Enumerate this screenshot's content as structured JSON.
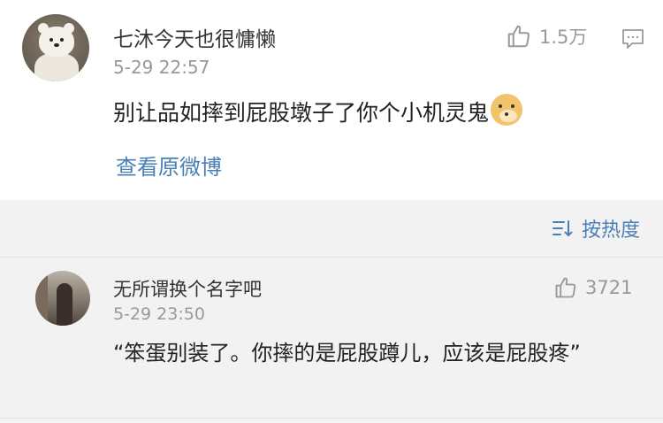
{
  "main_comment": {
    "username": "七沐今天也很慵懒",
    "timestamp": "5-29 22:57",
    "text": "别让品如摔到屁股墩子了你个小机灵鬼",
    "emoji": "doge-emoji",
    "like_count": "1.5万",
    "view_original": "查看原微博"
  },
  "sort": {
    "label": "按热度",
    "icon": "sort-icon"
  },
  "reply": {
    "username": "无所谓换个名字吧",
    "timestamp": "5-29 23:50",
    "text": "“笨蛋别装了。你摔的是屁股蹲儿，应该是屁股疼”",
    "like_count": "3721"
  },
  "colors": {
    "link": "#4a7fb5",
    "muted": "#999999",
    "background": "#f2f2f2"
  }
}
